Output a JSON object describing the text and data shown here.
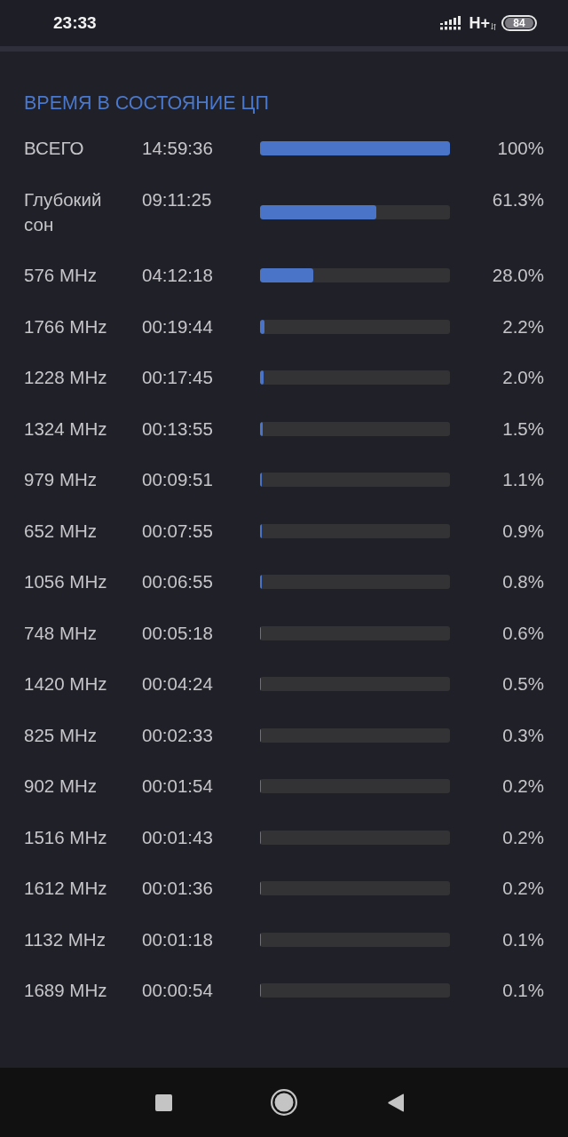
{
  "status_bar": {
    "time": "23:33",
    "network_type": "H+",
    "battery": "84"
  },
  "section": {
    "title": "ВРЕМЯ В СОСТОЯНИЕ ЦП",
    "rows": [
      {
        "name": "ВСЕГО",
        "time": "14:59:36",
        "level": 1,
        "percent": "100%"
      },
      {
        "name": "Глубокий сон",
        "time": "09:11:25",
        "level": 0.613,
        "percent": "61.3%"
      },
      {
        "name": "576 MHz",
        "time": "04:12:18",
        "level": 0.28,
        "percent": "28.0%"
      },
      {
        "name": "1766 MHz",
        "time": "00:19:44",
        "level": 0.022,
        "percent": "2.2%"
      },
      {
        "name": "1228 MHz",
        "time": "00:17:45",
        "level": 0.02,
        "percent": "2.0%"
      },
      {
        "name": "1324 MHz",
        "time": "00:13:55",
        "level": 0.015,
        "percent": "1.5%"
      },
      {
        "name": "979 MHz",
        "time": "00:09:51",
        "level": 0.011,
        "percent": "1.1%"
      },
      {
        "name": "652 MHz",
        "time": "00:07:55",
        "level": 0.009,
        "percent": "0.9%"
      },
      {
        "name": "1056 MHz",
        "time": "00:06:55",
        "level": 0.008,
        "percent": "0.8%"
      },
      {
        "name": "748 MHz",
        "time": "00:05:18",
        "level": 0.006,
        "percent": "0.6%"
      },
      {
        "name": "1420 MHz",
        "time": "00:04:24",
        "level": 0.005,
        "percent": "0.5%"
      },
      {
        "name": "825 MHz",
        "time": "00:02:33",
        "level": 0.003,
        "percent": "0.3%"
      },
      {
        "name": "902 MHz",
        "time": "00:01:54",
        "level": 0.002,
        "percent": "0.2%"
      },
      {
        "name": "1516 MHz",
        "time": "00:01:43",
        "level": 0.002,
        "percent": "0.2%"
      },
      {
        "name": "1612 MHz",
        "time": "00:01:36",
        "level": 0.002,
        "percent": "0.2%"
      },
      {
        "name": "1132 MHz",
        "time": "00:01:18",
        "level": 0.001,
        "percent": "0.1%"
      },
      {
        "name": "1689 MHz",
        "time": "00:00:54",
        "level": 0.001,
        "percent": "0.1%"
      }
    ]
  }
}
